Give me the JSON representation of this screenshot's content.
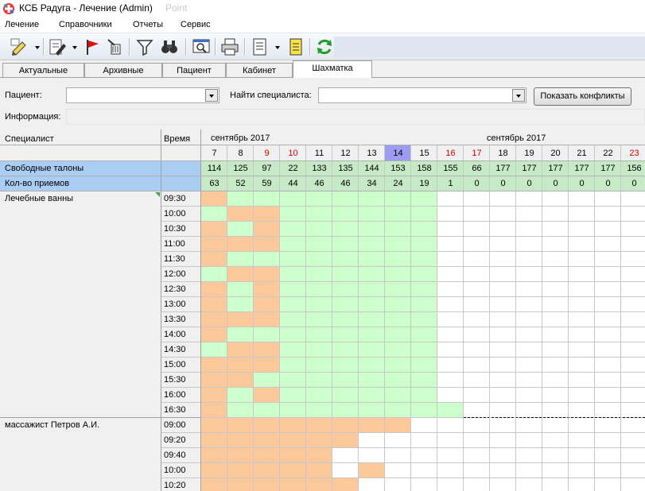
{
  "window": {
    "title": "КСБ Радуга - Лечение (Admin)",
    "title_ghost": "Point"
  },
  "menu": [
    "Лечение",
    "Справочники",
    "Отчеты",
    "Сервис"
  ],
  "toolbar": {
    "icons": [
      "edit-pencil-icon",
      "document-edit-icon",
      "flag-icon",
      "broom-icon",
      "filter-icon",
      "binoculars-icon",
      "preview-icon",
      "printer-icon",
      "document-list-icon",
      "notepad-icon",
      "refresh-icon"
    ]
  },
  "tabs": [
    "Актуальные",
    "Архивные",
    "Пациент",
    "Кабинет",
    "Шахматка"
  ],
  "active_tab": 4,
  "filters": {
    "patient_label": "Пациент:",
    "patient_value": "",
    "specialist_label": "Найти специалиста:",
    "specialist_value": "",
    "show_conflicts": "Показать конфликты",
    "info_label": "Информация:",
    "info_value": ""
  },
  "grid": {
    "col_specialist": "Специалист",
    "col_time": "Время",
    "month_labels": [
      "сентябрь 2017",
      "сентябрь 2017"
    ],
    "days": [
      "7",
      "8",
      "9",
      "10",
      "11",
      "12",
      "13",
      "14",
      "15",
      "16",
      "17",
      "18",
      "19",
      "20",
      "21",
      "22",
      "23"
    ],
    "weekend_days": [
      "9",
      "10",
      "16",
      "17",
      "23"
    ],
    "selected_day": "14",
    "free_label": "Свободные талоны",
    "free_values": [
      "114",
      "125",
      "97",
      "22",
      "133",
      "135",
      "144",
      "153",
      "158",
      "155",
      "66",
      "177",
      "177",
      "177",
      "177",
      "177",
      "156"
    ],
    "count_label": "Кол-во приемов",
    "count_values": [
      "63",
      "52",
      "59",
      "44",
      "46",
      "46",
      "34",
      "24",
      "19",
      "1",
      "0",
      "0",
      "0",
      "0",
      "0",
      "0",
      "0"
    ],
    "colors": {
      "busy": "#fdc99b",
      "free": "#ccffcc",
      "empty": "#ffffff",
      "header_blue": "#a9cdf3",
      "summary_green": "#c6e9c6",
      "selected_day": "#9c9cf0",
      "weekend_text": "#d40000"
    },
    "specialists": [
      {
        "name": "Лечебные ванны",
        "times": [
          "09:30",
          "10:00",
          "10:30",
          "11:00",
          "11:30",
          "12:00",
          "12:30",
          "13:00",
          "13:30",
          "14:00",
          "14:30",
          "15:00",
          "15:30",
          "16:00",
          "16:30"
        ],
        "rows": [
          "BFFFFFFFF",
          "FBBFFFFFF",
          "BFBFFFFFF",
          "BBBFFFFFF",
          "BFFFFFFFF",
          "FBBFFFFFF",
          "BFBFFFFFF",
          "BFBFFFFFF",
          "BBBFFFFFF",
          "BFFFFFFFF",
          "FBBFFFFFF",
          "BBBFFFFFF",
          "BBFFFFFFF",
          "BFBFFFFFF",
          "BFFFFFFFFF"
        ]
      },
      {
        "name": "массажист Петров А.И.",
        "times": [
          "09:00",
          "09:20",
          "09:40",
          "10:00",
          "10:20"
        ],
        "rows": [
          "BBBBBBBB",
          "BBBBBB",
          "BBBBB",
          "BBBBBEB",
          "BBBBBB"
        ]
      }
    ]
  }
}
